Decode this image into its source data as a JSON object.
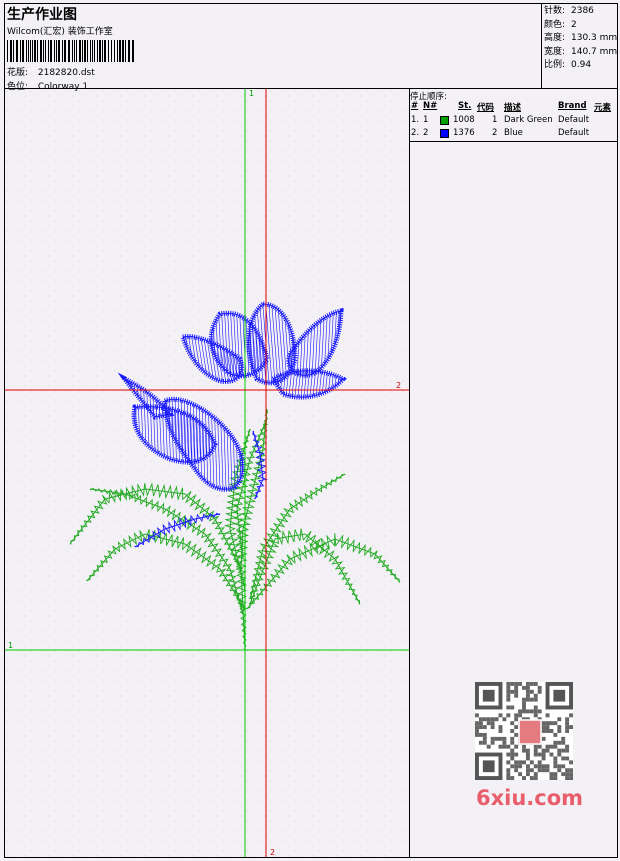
{
  "header": {
    "title": "生产作业图",
    "studio": "Wilcom(汇宏) 装饰工作室",
    "pattern_label": "花版:",
    "pattern_value": "2182820.dst",
    "color_label": "色位:",
    "color_value": "Colorway 1"
  },
  "stats": {
    "stitches_label": "针数:",
    "stitches_value": "2386",
    "colors_label": "颜色:",
    "colors_value": "2",
    "height_label": "高度:",
    "height_value": "130.3 mm",
    "width_label": "宽度:",
    "width_value": "140.7 mm",
    "scale_label": "比例:",
    "scale_value": "0.94"
  },
  "stop_sequence": {
    "title": "停止顺序:",
    "columns": [
      "#",
      "N#",
      "St.",
      "代码",
      "描述",
      "Brand",
      "元素"
    ],
    "rows": [
      {
        "index": "1.",
        "n": "1",
        "swatch": "#00a000",
        "stitches": "1008",
        "code": "1",
        "description": "Dark Green",
        "brand": "Default"
      },
      {
        "index": "2.",
        "n": "2",
        "swatch": "#0000ff",
        "stitches": "1376",
        "code": "2",
        "description": "Blue",
        "brand": "Default"
      }
    ]
  },
  "design": {
    "guide_labels": {
      "green_top": "1",
      "green_left": "1",
      "red_right": "2",
      "red_bottom": "2"
    },
    "colors": {
      "green": "#22aa22",
      "blue": "#1a1aff",
      "guide_green": "#00cc00",
      "guide_red": "#e00000"
    }
  },
  "watermark": {
    "text": "6xiu.com",
    "badge": "印信图"
  }
}
